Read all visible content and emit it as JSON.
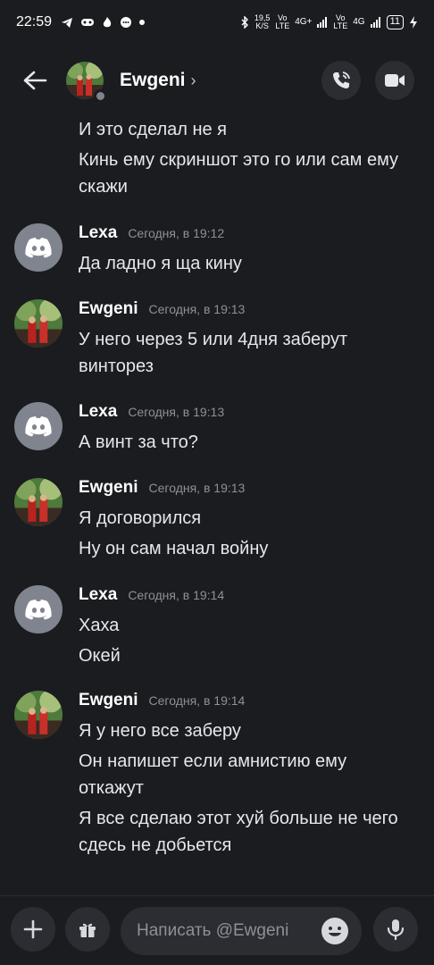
{
  "status_bar": {
    "time": "22:59",
    "speed_value": "19,5",
    "speed_unit": "K/S",
    "net1_top": "Vo",
    "net1_bottom": "LTE",
    "net1_type": "4G+",
    "net2_top": "Vo",
    "net2_bottom": "LTE",
    "net2_type": "4G",
    "battery": "11"
  },
  "header": {
    "contact_name": "Ewgeni",
    "chevron": "›"
  },
  "messages": {
    "continuation": [
      "И это сделал не я",
      "Кинь ему скриншот это го или сам ему",
      "скажи"
    ],
    "groups": [
      {
        "author": "Lexa",
        "time": "Сегодня, в 19:12",
        "lines": [
          "Да ладно я ща кину"
        ]
      },
      {
        "author": "Ewgeni",
        "time": "Сегодня, в 19:13",
        "lines": [
          "У него через 5 или 4дня заберут",
          "винторез"
        ]
      },
      {
        "author": "Lexa",
        "time": "Сегодня, в 19:13",
        "lines": [
          "А винт за что?"
        ]
      },
      {
        "author": "Ewgeni",
        "time": "Сегодня, в 19:13",
        "lines": [
          "Я договорился",
          "Ну он сам начал войну"
        ]
      },
      {
        "author": "Lexa",
        "time": "Сегодня, в 19:14",
        "lines": [
          "Хаха",
          "Окей"
        ]
      },
      {
        "author": "Ewgeni",
        "time": "Сегодня, в 19:14",
        "lines": [
          "Я у него все заберу",
          "Он напишет если амнистию ему",
          "откажут",
          "Я все сделаю этот хуй больше не чего",
          "сдесь не добьется"
        ]
      }
    ]
  },
  "composer": {
    "placeholder": "Написать @Ewgeni"
  },
  "icons": {
    "back": "arrow-left-icon",
    "call": "phone-icon",
    "video": "video-camera-icon",
    "add": "plus-icon",
    "gift": "gift-icon",
    "emoji": "smile-icon",
    "mic": "microphone-icon"
  },
  "colors": {
    "background": "#1b1c20",
    "surface": "#2b2d33",
    "text": "#e6e7ea",
    "muted": "#8e9098",
    "discord_default_avatar": "#80848e"
  }
}
